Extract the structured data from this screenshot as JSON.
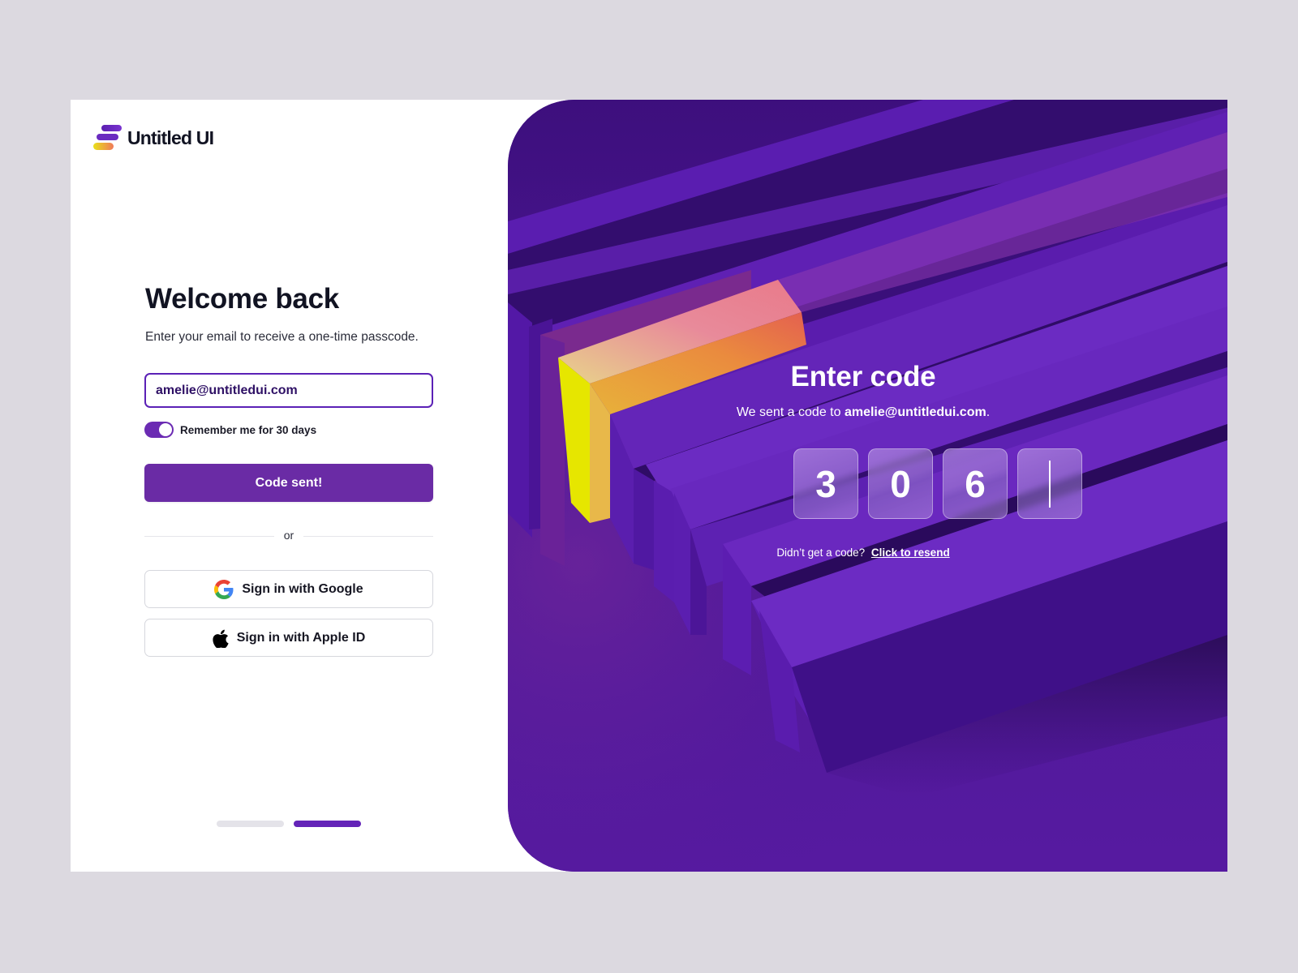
{
  "brand": {
    "name": "Untitled UI",
    "logo_icon": "untitled-ui-logo-icon",
    "colors": {
      "primary": "#6a2ba5",
      "primary_dark": "#4e1899",
      "accent_yellow": "#e5e500",
      "accent_orange": "#e8893d",
      "text": "#111322",
      "page_bg": "#dcd9e0"
    }
  },
  "login": {
    "title": "Welcome back",
    "subtitle": "Enter your email to receive a one-time passcode.",
    "email_value": "amelie@untitledui.com",
    "remember": {
      "label": "Remember me for 30 days",
      "checked": true
    },
    "submit_label": "Code sent!",
    "divider_label": "or",
    "social": [
      {
        "label": "Sign in with Google",
        "icon": "google-icon"
      },
      {
        "label": "Sign in with Apple ID",
        "icon": "apple-icon"
      }
    ],
    "pagination": {
      "total_steps": 2,
      "current_step": 2
    }
  },
  "otp": {
    "title": "Enter code",
    "sent_prefix": "We sent a code to ",
    "sent_email": "amelie@untitledui.com",
    "sent_suffix": ".",
    "digits": [
      "3",
      "0",
      "6",
      ""
    ],
    "resend_prompt": "Didn’t get a code?",
    "resend_link": "Click to resend"
  }
}
